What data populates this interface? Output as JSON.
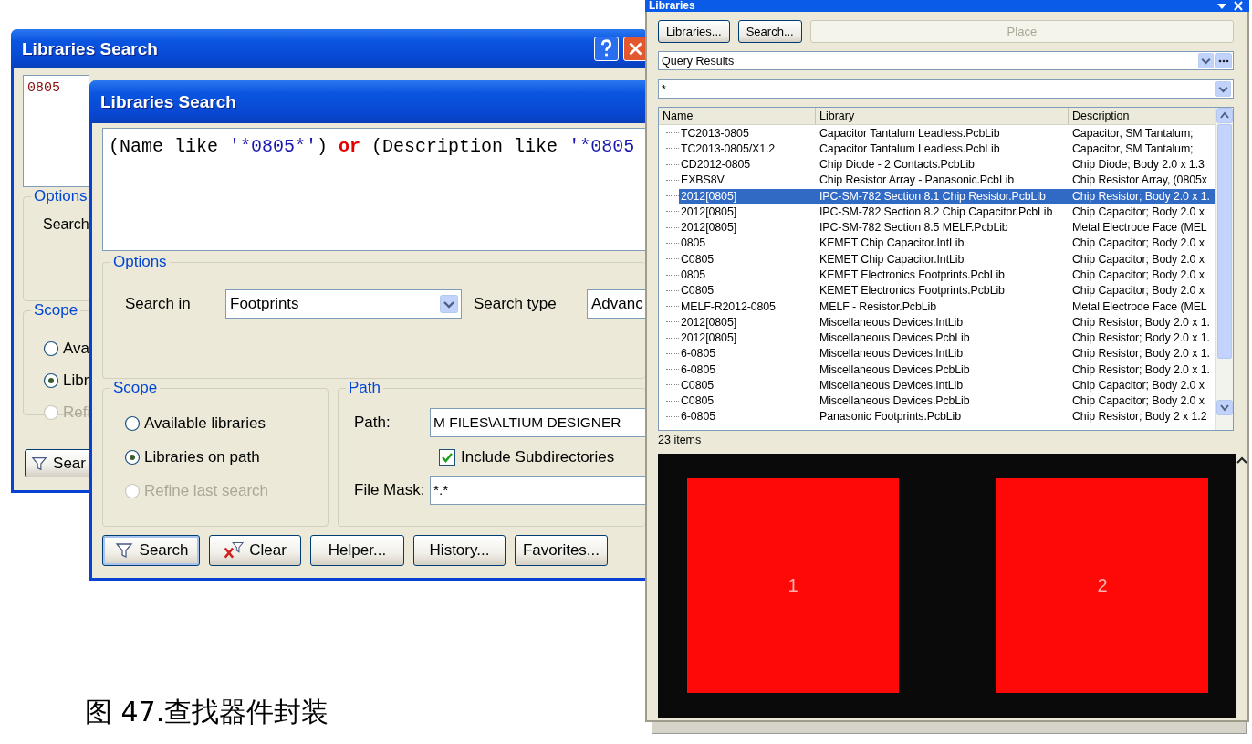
{
  "back_dialog": {
    "title": "Libraries Search",
    "query": "0805",
    "options_group": "Options",
    "search_in_label": "Search",
    "scope_group": "Scope",
    "scope_options": [
      {
        "label": "Ava",
        "selected": false,
        "disabled": false
      },
      {
        "label": "Libr",
        "selected": true,
        "disabled": false
      },
      {
        "label": "Refi",
        "selected": false,
        "disabled": true
      }
    ],
    "search_button": "Sear"
  },
  "front_dialog": {
    "title": "Libraries Search",
    "query": [
      {
        "kind": "plain",
        "text": "(Name like "
      },
      {
        "kind": "string",
        "text": "'*0805*'"
      },
      {
        "kind": "plain",
        "text": ") "
      },
      {
        "kind": "keyword",
        "text": "or"
      },
      {
        "kind": "plain",
        "text": " (Description like "
      },
      {
        "kind": "string",
        "text": "'*0805"
      }
    ],
    "options_group": "Options",
    "search_in": {
      "label": "Search in",
      "value": "Footprints"
    },
    "search_type": {
      "label": "Search type",
      "value": "Advanc"
    },
    "scope_group": "Scope",
    "scope_options": [
      {
        "label": "Available libraries",
        "selected": false,
        "disabled": false
      },
      {
        "label": "Libraries on path",
        "selected": true,
        "disabled": false
      },
      {
        "label": "Refine last search",
        "selected": false,
        "disabled": true
      }
    ],
    "path_group": "Path",
    "path": {
      "label": "Path:",
      "value": "M FILES\\ALTIUM DESIGNER"
    },
    "include_subdirectories": {
      "label": "Include Subdirectories",
      "checked": true
    },
    "file_mask": {
      "label": "File Mask:",
      "value": "*.*"
    },
    "buttons": [
      {
        "label": "Search",
        "kind": "search"
      },
      {
        "label": "Clear",
        "kind": "clear"
      },
      {
        "label": "Helper...",
        "kind": "plain"
      },
      {
        "label": "History...",
        "kind": "plain"
      },
      {
        "label": "Favorites...",
        "kind": "plain"
      }
    ]
  },
  "libraries_panel": {
    "title": "Libraries",
    "buttons": [
      {
        "label": "Libraries...",
        "disabled": false
      },
      {
        "label": "Search...",
        "disabled": false
      },
      {
        "label": "Place",
        "disabled": true
      }
    ],
    "library_select": "Query Results",
    "filter": "*",
    "table": {
      "columns": [
        "Name",
        "Library",
        "Description"
      ],
      "rows": [
        {
          "name": "TC2013-0805",
          "library": "Capacitor Tantalum Leadless.PcbLib",
          "description": "Capacitor, SM Tantalum;",
          "selected": false
        },
        {
          "name": "TC2013-0805/X1.2",
          "library": "Capacitor Tantalum Leadless.PcbLib",
          "description": "Capacitor, SM Tantalum;",
          "selected": false
        },
        {
          "name": "CD2012-0805",
          "library": "Chip Diode - 2 Contacts.PcbLib",
          "description": "Chip Diode; Body 2.0 x 1.3",
          "selected": false
        },
        {
          "name": "EXBS8V",
          "library": "Chip Resistor Array - Panasonic.PcbLib",
          "description": "Chip Resistor Array, (0805x",
          "selected": false
        },
        {
          "name": "2012[0805]",
          "library": "IPC-SM-782 Section 8.1 Chip Resistor.PcbLib",
          "description": "Chip Resistor; Body 2.0 x 1.",
          "selected": true
        },
        {
          "name": "2012[0805]",
          "library": "IPC-SM-782 Section 8.2 Chip Capacitor.PcbLib",
          "description": "Chip Capacitor; Body 2.0 x",
          "selected": false
        },
        {
          "name": "2012[0805]",
          "library": "IPC-SM-782 Section 8.5 MELF.PcbLib",
          "description": "Metal Electrode Face (MEL",
          "selected": false
        },
        {
          "name": "0805",
          "library": "KEMET Chip Capacitor.IntLib",
          "description": "Chip Capacitor; Body 2.0 x",
          "selected": false
        },
        {
          "name": "C0805",
          "library": "KEMET Chip Capacitor.IntLib",
          "description": "Chip Capacitor; Body 2.0 x",
          "selected": false
        },
        {
          "name": "0805",
          "library": "KEMET Electronics Footprints.PcbLib",
          "description": "Chip Capacitor; Body 2.0 x",
          "selected": false
        },
        {
          "name": "C0805",
          "library": "KEMET Electronics Footprints.PcbLib",
          "description": "Chip Capacitor; Body 2.0 x",
          "selected": false
        },
        {
          "name": "MELF-R2012-0805",
          "library": "MELF - Resistor.PcbLib",
          "description": "Metal Electrode Face (MEL",
          "selected": false
        },
        {
          "name": "2012[0805]",
          "library": "Miscellaneous Devices.IntLib",
          "description": "Chip Resistor; Body 2.0 x 1.",
          "selected": false
        },
        {
          "name": "2012[0805]",
          "library": "Miscellaneous Devices.PcbLib",
          "description": "Chip Resistor; Body 2.0 x 1.",
          "selected": false
        },
        {
          "name": "6-0805",
          "library": "Miscellaneous Devices.IntLib",
          "description": "Chip Resistor; Body 2.0 x 1.",
          "selected": false
        },
        {
          "name": "6-0805",
          "library": "Miscellaneous Devices.PcbLib",
          "description": "Chip Resistor; Body 2.0 x 1.",
          "selected": false
        },
        {
          "name": "C0805",
          "library": "Miscellaneous Devices.IntLib",
          "description": "Chip Capacitor; Body 2.0 x",
          "selected": false
        },
        {
          "name": "C0805",
          "library": "Miscellaneous Devices.PcbLib",
          "description": "Chip Capacitor; Body 2.0 x",
          "selected": false
        },
        {
          "name": "6-0805",
          "library": "Panasonic Footprints.PcbLib",
          "description": "Chip Resistor; Body 2 x 1.2",
          "selected": false
        }
      ]
    },
    "status": "23 items",
    "pads": [
      {
        "label": "1"
      },
      {
        "label": "2"
      }
    ]
  },
  "caption": "图 47.查找器件封装"
}
